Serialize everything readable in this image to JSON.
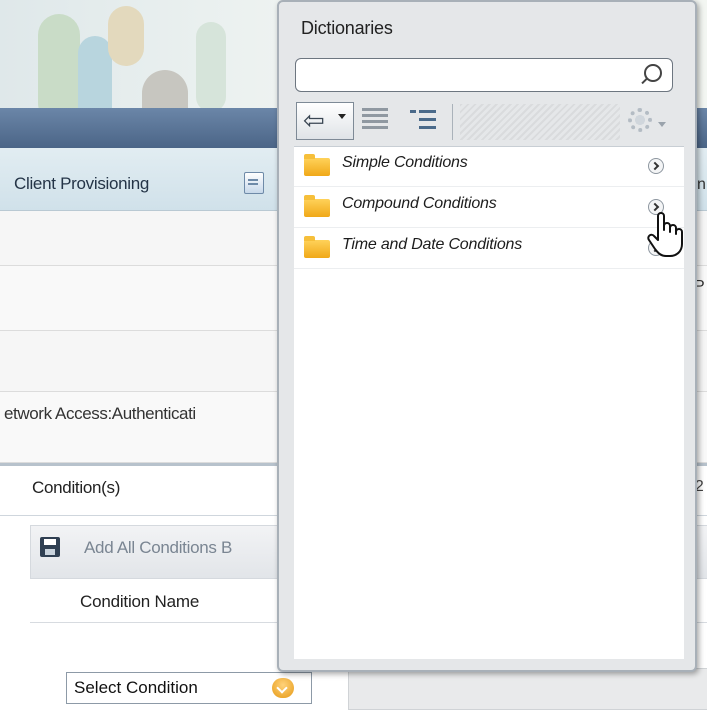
{
  "app": {
    "tab_label": "Client Provisioning",
    "rule_text": "etwork Access:Authenticati",
    "right_peek_tab": "n",
    "right_peek_row": "P",
    "right_peek_cond": "h2"
  },
  "conditions": {
    "title": "Condition(s)",
    "add_all_label": "Add All Conditions B",
    "column_header": "Condition Name",
    "select_value": "Select Condition"
  },
  "dictionaries": {
    "title": "Dictionaries",
    "search_placeholder": "",
    "items": [
      {
        "label": "Simple Conditions",
        "icon": "folder-icon"
      },
      {
        "label": "Compound Conditions",
        "icon": "folder-icon"
      },
      {
        "label": "Time and Date Conditions",
        "icon": "folder-icon"
      }
    ],
    "toolbar_icons": [
      "back-arrow-icon",
      "list-view-icon",
      "tree-view-icon",
      "gear-icon"
    ]
  },
  "colors": {
    "header_blue": "#4b6587",
    "folder_yellow": "#f0a818",
    "select_arrow_orange": "#e69a16"
  }
}
